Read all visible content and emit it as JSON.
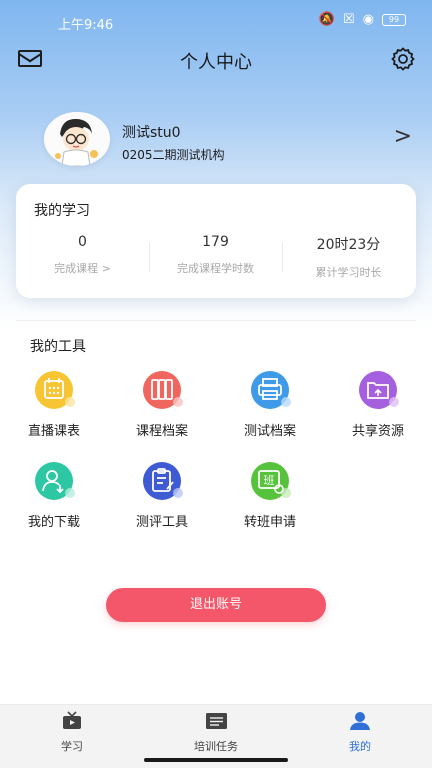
{
  "status": {
    "time": "上午9:46",
    "battery": "99"
  },
  "nav": {
    "title": "个人中心"
  },
  "profile": {
    "name": "测试stu0",
    "org": "0205二期测试机构",
    "arrow": ">"
  },
  "study": {
    "title": "我的学习",
    "stats": [
      {
        "value": "0",
        "label": "完成课程 >"
      },
      {
        "value": "179",
        "label": "完成课程学时数"
      },
      {
        "value": "20时23分",
        "label": "累计学习时长"
      }
    ]
  },
  "tools": {
    "title": "我的工具",
    "items": [
      {
        "label": "直播课表",
        "icon": "calendar-icon",
        "color": "#f7c534"
      },
      {
        "label": "课程档案",
        "icon": "books-icon",
        "color": "#f0665f"
      },
      {
        "label": "测试档案",
        "icon": "printer-icon",
        "color": "#3f9be8"
      },
      {
        "label": "共享资源",
        "icon": "folder-share-icon",
        "color": "#a560e0"
      },
      {
        "label": "我的下载",
        "icon": "user-download-icon",
        "color": "#2dc7a3"
      },
      {
        "label": "测评工具",
        "icon": "clipboard-icon",
        "color": "#3e5bd4"
      },
      {
        "label": "转班申请",
        "icon": "class-transfer-icon",
        "color": "#57c23c"
      }
    ]
  },
  "logout": {
    "label": "退出账号"
  },
  "tabbar": {
    "items": [
      {
        "label": "学习"
      },
      {
        "label": "培训任务"
      },
      {
        "label": "我的"
      }
    ],
    "active_color": "#2f6fd6"
  }
}
